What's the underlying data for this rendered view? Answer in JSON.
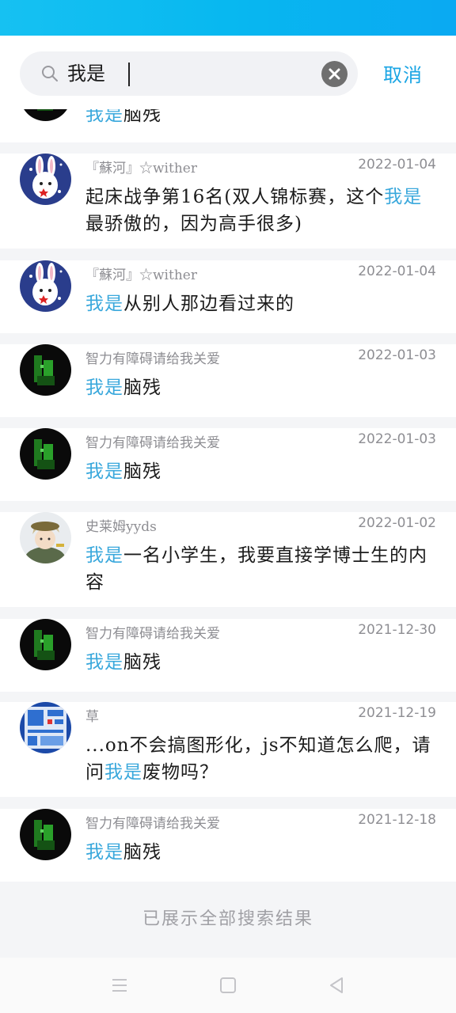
{
  "search": {
    "value": "我是",
    "cancel_label": "取消"
  },
  "highlight": "我是",
  "results": [
    {
      "user": "",
      "date": "",
      "before": "",
      "after": "脑残"
    },
    {
      "user": "『蘇河』☆wither",
      "date": "2022-01-04",
      "before": "起床战争第16名(双人锦标赛，这个",
      "after": "最骄傲的，因为高手很多)"
    },
    {
      "user": "『蘇河』☆wither",
      "date": "2022-01-04",
      "before": "",
      "after": "从别人那边看过来的"
    },
    {
      "user": "智力有障碍请给我关爱",
      "date": "2022-01-03",
      "before": "",
      "after": "脑残"
    },
    {
      "user": "智力有障碍请给我关爱",
      "date": "2022-01-03",
      "before": "",
      "after": "脑残"
    },
    {
      "user": "史莱姆yyds",
      "date": "2022-01-02",
      "before": "",
      "after": "一名小学生，我要直接学博士生的内容"
    },
    {
      "user": "智力有障碍请给我关爱",
      "date": "2021-12-30",
      "before": "",
      "after": "脑残"
    },
    {
      "user": "草",
      "date": "2021-12-19",
      "before": "...on不会搞图形化，js不知道怎么爬，请问",
      "after": "废物吗？"
    },
    {
      "user": "智力有障碍请给我关爱",
      "date": "2021-12-18",
      "before": "",
      "after": "脑残"
    }
  ],
  "footer": "已展示全部搜索结果",
  "colors": {
    "accent": "#3aa8dc",
    "status_bar": "#0ab8f0"
  },
  "icons": {
    "search": "search-icon",
    "clear": "clear-circle-icon",
    "nav_menu": "menu-icon",
    "nav_home": "square-icon",
    "nav_back": "back-triangle-icon"
  }
}
